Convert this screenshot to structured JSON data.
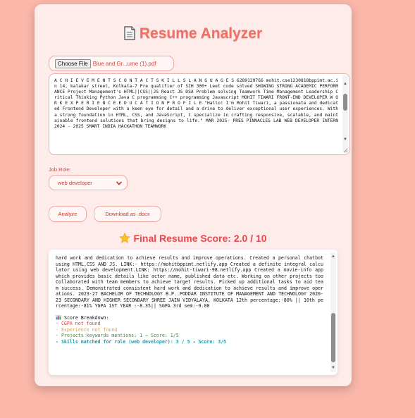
{
  "app": {
    "title": "Resume Analyzer",
    "title_icon": "page-document-icon"
  },
  "file": {
    "button_label": "Choose File",
    "file_name": "Blue and Gr...ume (1).pdf"
  },
  "resume_text": "A C H I E V E M E N T S  C O N T A C T  S K I L L S  L A N G U A G E S  6289129766 mohit.cse1230818bppimt.ac.in  14, kalakar street, Kolkata-7  Pre qualifier of SIH 300+ Leet code solved  SHOWING STRONG ACADEMIC  PERFORMANCE  Project Management's HTML||CSS||JS  React JS  DSA  Problem solving  Teamwork  Time Management Leadership  Critical Thinking  Python  Java  C programming  C++ programming Javascript  MOHIT TIWARI  FRONT-END DEVELOPER  W O R K E X P E R I E N C E  E D U C A T I O N  P R O F I L E  \"Hallo! I'm Mohit Tiwari, a passionate and dedicated Frontend Developer  with  a  keen  eye  for  detail  and  a  drive  to deliver  exceptional  user experiences. With a strong foundation in HTML, CSS, and JavaScript, I  specialize  in  crafting  responsive,  scalable,  and maintainable  frontend  solutions that bring designs to life.\"  MAR 2025- PRES PINNACLES LAB  WEB DEVELOPER INTERN  2024 - 2025  SMART INDIA HACKATHON  TEAMWORK",
  "job_role": {
    "label": "Job Role:",
    "selected": "web developer"
  },
  "buttons": {
    "analyze": "Analyze",
    "download": "Download as .docx"
  },
  "score": {
    "icon": "star-icon",
    "label": "Final Resume Score: 2.0 / 10"
  },
  "output": {
    "text": "hard work and dedication to achieve results  and improve operations.  Created  a  personal  chatbot  using  HTML,CSS  AND  JS.  LINK:- https://mohitbppimt.netlify.app  Created  a  definite  integral calculator  using  web  development.LINK: https://mohit-tiwari-98.netlify.app  Created a movie-info app which provides basic details like actor  name, published data etc.  Working on other projects too  Collaborated with team members to achieve target results.  Picked up additional tasks to aid team success.  Demonstrated consistent hard work and dedication to achieve results  and improve operations.  2023-27 BACHELOR OF TECHNOLOGY B.P..PODDAR INSTITUTE OF MANAGEMENT AND TECHNOLOGY  2020-23 SECONDARY AND HIGHER SECONDARY  SHREE JAIN VIDYALAYA, KOLKATA  12th percentage:-80% || 10th percentage:-81%  YGPA 1ST YEAR :-8.35|| SGPA 3rd sem:-9.00",
    "breakdown_title": "Score Breakdown:",
    "breakdown_icon": "bar-chart-icon",
    "breakdown": [
      {
        "text": "- CGPA not found",
        "color": "#e53935"
      },
      {
        "text": "- Experience not found",
        "color": "#f29a2e"
      },
      {
        "text": "- Projects keywords mentions: 1 → Score: 1/5",
        "color": "#3a8a44"
      },
      {
        "text": "- Skills matched for role (web developer): 3 / 5 → Score: 3/5",
        "color": "#1e9aa8"
      }
    ]
  }
}
